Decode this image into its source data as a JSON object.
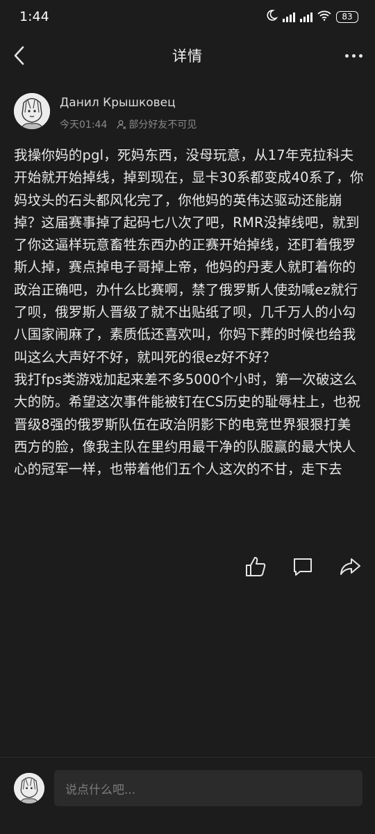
{
  "status_bar": {
    "time": "1:44",
    "battery": "83",
    "icons": [
      "moon-icon",
      "hd-signal-icon",
      "hd-signal-icon",
      "wifi-icon",
      "battery-icon"
    ]
  },
  "nav": {
    "title": "详情",
    "back_icon": "chevron-left-icon",
    "more_icon": "more-dots-icon"
  },
  "post": {
    "author": "Данил Крышковец",
    "time": "今天01:44",
    "visibility": "部分好友不可见",
    "paragraph_1": "我操你妈的pgl，死妈东西，没母玩意，从17年克拉科夫开始就开始掉线，掉到现在，显卡30系都变成40系了，你妈坟头的石头都风化完了，你他妈的英伟达驱动还能崩掉？这届赛事掉了起码七八次了吧，RMR没掉线吧，就到了你这逼样玩意畜牲东西办的正赛开始掉线，还盯着俄罗斯人掉，赛点掉电子哥掉上帝，他妈的丹麦人就盯着你的政治正确吧，办什么比赛啊，禁了俄罗斯人使劲喊ez就行了呗，俄罗斯人晋级了就不出贴纸了呗，几千万人的小勾八国家闹麻了，素质低还喜欢叫，你妈下葬的时候也给我叫这么大声好不好，就叫死的很ez好不好？",
    "paragraph_2": "我打fps类游戏加起来差不多5000个小时，第一次破这么大的防。希望这次事件能被钉在CS历史的耻辱柱上，也祝晋级8强的俄罗斯队伍在政治阴影下的电竞世界狠狠打美西方的脸，像我主队在里约用最干净的队服赢的最大快人心的冠军一样，也带着他们五个人这次的不甘，走下去"
  },
  "actions": [
    "like-icon",
    "comment-icon",
    "share-icon"
  ],
  "comment_bar": {
    "placeholder": "说点什么吧..."
  }
}
